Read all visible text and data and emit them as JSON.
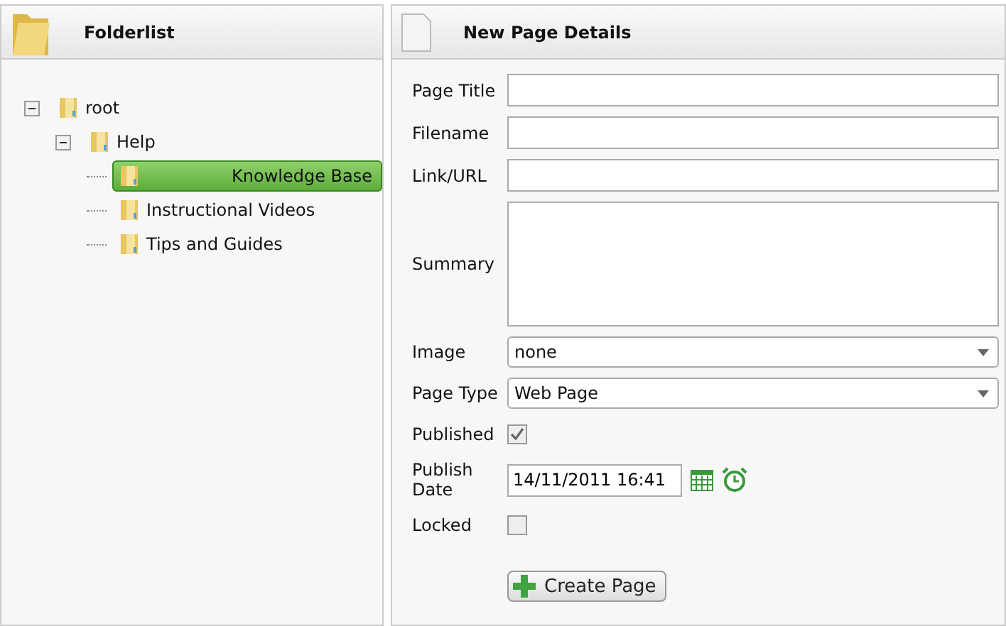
{
  "folderlist": {
    "title": "Folderlist",
    "tree": [
      {
        "label": "root",
        "expanded": true,
        "selected": false,
        "children": [
          {
            "label": "Help",
            "expanded": true,
            "selected": false,
            "children": [
              {
                "label": "Knowledge Base",
                "selected": true
              },
              {
                "label": "Instructional Videos",
                "selected": false
              },
              {
                "label": "Tips and Guides",
                "selected": false
              }
            ]
          }
        ]
      }
    ]
  },
  "details": {
    "title": "New Page Details",
    "fields": [
      {
        "kind": "text",
        "label": "Page Title"
      },
      {
        "kind": "text",
        "label": "Filename"
      },
      {
        "kind": "text",
        "label": "Link/URL"
      },
      {
        "kind": "textarea",
        "label": "Summary"
      },
      {
        "kind": "select",
        "label": "Image",
        "value": "none"
      },
      {
        "kind": "select",
        "label": "Page Type",
        "value": "Web Page"
      },
      {
        "kind": "checkbox",
        "label": "Published",
        "checked": true
      },
      {
        "kind": "date",
        "label": "Publish Date",
        "value": "14/11/2011 16:41"
      },
      {
        "kind": "checkbox",
        "label": "Locked",
        "checked": false
      }
    ],
    "button": "Create Page"
  }
}
